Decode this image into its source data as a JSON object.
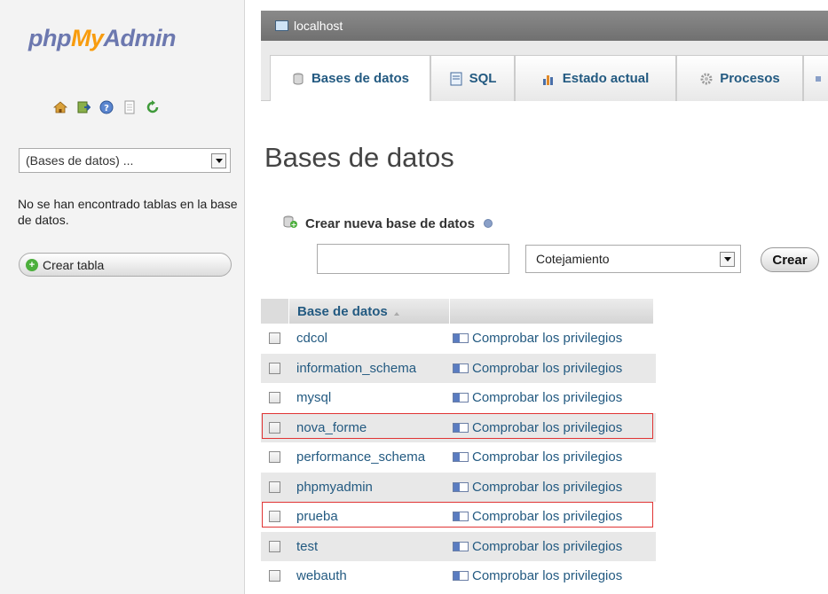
{
  "nav": {
    "logo": {
      "part1": "php",
      "part2": "My",
      "part3": "Admin"
    },
    "icons": [
      "home-icon",
      "logout-icon",
      "help-icon",
      "docs-icon",
      "reload-icon"
    ],
    "db_select_value": "(Bases de datos) ...",
    "no_tables_message": "No se han encontrado tablas en la base de datos.",
    "create_table_label": "Crear tabla"
  },
  "server_bar": {
    "label": "localhost"
  },
  "tabs": [
    {
      "label": "Bases de datos",
      "icon": "database-icon",
      "active": true
    },
    {
      "label": "SQL",
      "icon": "sql-icon",
      "active": false
    },
    {
      "label": "Estado actual",
      "icon": "status-chart-icon",
      "active": false
    },
    {
      "label": "Procesos",
      "icon": "gear-icon",
      "active": false
    }
  ],
  "main": {
    "title": "Bases de datos",
    "create_db": {
      "label": "Crear nueva base de datos",
      "name_value": "",
      "collation_value": "Cotejamiento",
      "submit_label": "Crear"
    },
    "table": {
      "column_header": "Base de datos",
      "privileges_label": "Comprobar los privilegios",
      "rows": [
        {
          "name": "cdcol",
          "highlighted": false
        },
        {
          "name": "information_schema",
          "highlighted": false
        },
        {
          "name": "mysql",
          "highlighted": false
        },
        {
          "name": "nova_forme",
          "highlighted": true
        },
        {
          "name": "performance_schema",
          "highlighted": false
        },
        {
          "name": "phpmyadmin",
          "highlighted": false
        },
        {
          "name": "prueba",
          "highlighted": true
        },
        {
          "name": "test",
          "highlighted": false
        },
        {
          "name": "webauth",
          "highlighted": false
        }
      ]
    }
  },
  "colors": {
    "link": "#235a81",
    "logo_blue": "#6c78af",
    "logo_orange": "#f89c0e",
    "highlight_border": "#e03434"
  }
}
